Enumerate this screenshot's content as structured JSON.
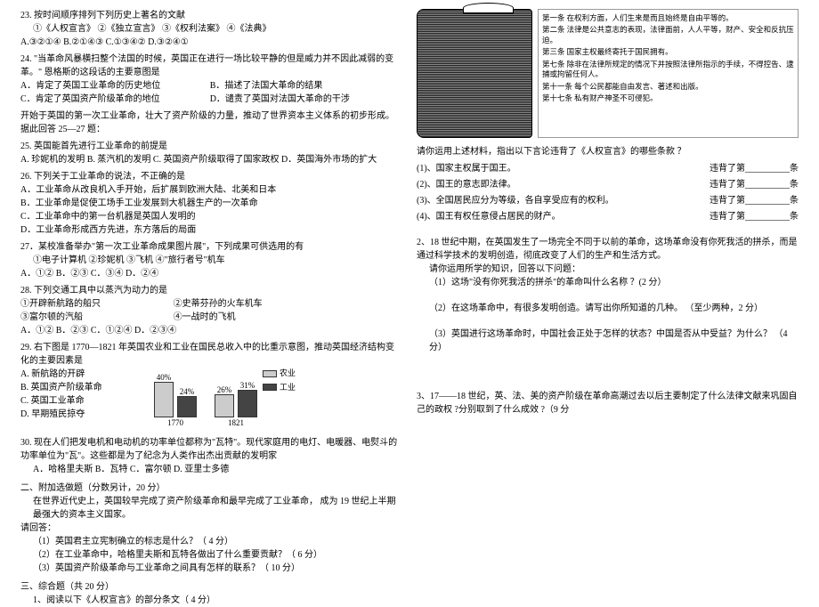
{
  "left": {
    "q23": {
      "stem": "23. 按时间顺序排列下列历史上著名的文献",
      "items": "①《人权宣言》 ②《独立宣言》 ③《权利法案》 ④《法典》",
      "opts": "A.③②①④     B.②①④③     C.①③④②     D.③②④①"
    },
    "q24": {
      "stem": "24. \"当革命风暴横扫整个法国的时候，英国正在进行一场比较平静的但是威力并不因此减弱的变革。\" 恩格斯的这段话的主要意图是",
      "a": "A．肯定了英国工业革命的历史地位",
      "b": "B．描述了法国大革命的结果",
      "c": "C．肯定了英国资产阶级革命的地位",
      "d": "D．谴责了英国对法国大革命的干涉"
    },
    "group25_27": "开始于英国的第一次工业革命，壮大了资产阶级的力量，推动了世界资本主义体系的初步形成。据此回答 25—27 题：",
    "q25": {
      "stem": "25. 英国能首先进行工业革命的前提是",
      "opts": "A. 珍妮机的发明   B. 蒸汽机的发明   C. 英国资产阶级取得了国家政权   D．英国海外市场的扩大"
    },
    "q26": {
      "stem": "26. 下列关于工业革命的说法，不正确的是",
      "a": "A．工业革命从改良机入手开始，后扩展到欧洲大陆、北美和日本",
      "b": "B．工业革命是促使工场手工业发展到大机器生产的一次革命",
      "c": "C．工业革命中的第一台机器是英国人发明的",
      "d": "D．工业革命形成西方先进，东方落后的局面"
    },
    "q27": {
      "stem": "27．某校准备举办\"第一次工业革命成果图片展\"，下列成果可供选用的有",
      "items": "①电子计算机   ②珍妮机   ③飞机   ④\"旅行者号\"机车",
      "opts": "A．①②   B．②③   C．③④   D．②④"
    },
    "q28": {
      "stem": "28. 下列交通工具中以蒸汽为动力的是",
      "row1a": "①开辟新航路的船只",
      "row1b": "②史蒂芬孙的火车机车",
      "row2a": "③富尔顿的汽船",
      "row2b": "④一战时的飞机",
      "opts": "A．①②   B．②③   C．①②④   D．②③④"
    },
    "q29": {
      "stem": "29. 右下图是 1770—1821 年英国农业和工业在国民总收入中的比重示意图，推动英国经济结构变化的主要因素是",
      "a": "A. 新航路的开辟",
      "b": "B. 英国资产阶级革命",
      "c": "C. 英国工业革命",
      "d": "D. 早期殖民掠夺",
      "x1": "1770",
      "x2": "1821",
      "leg_a": "农业",
      "leg_b": "工业"
    },
    "q30": {
      "stem": "30. 现在人们把发电机和电动机的功率单位都称为\"瓦特\"。现代家庭用的电灯、电暖器、电熨斗的功率单位为\"瓦\"。这些都是为了纪念为人类作出杰出贡献的发明家",
      "opts": "A．哈格里夫斯   B．瓦特   C．富尔顿   D. 亚里士多德"
    },
    "part2": {
      "title": "二、附加选做题（分数另计，20 分）",
      "intro": "在世界近代史上，英国较早完成了资产阶级革命和最早完成了工业革命，    成为 19 世纪上半期最强大的资本主义国家。",
      "ask": "请回答：",
      "sub1": "（1）英国君主立宪制确立的标志是什么？（  4 分）",
      "sub2": "（2）在工业革命中，哈格里夫斯和瓦特各做出了什么重要贡献？（  6 分）",
      "sub3": "（3）英国资产阶级革命与工业革命之间具有怎样的联系？（  10 分）"
    },
    "part3": {
      "title": "三、综合题（共 20 分）",
      "sub1": "1、阅读以下《人权宣言》的部分条文（  4 分）"
    }
  },
  "chart_data": {
    "type": "bar",
    "categories": [
      "1770",
      "1821"
    ],
    "series": [
      {
        "name": "农业",
        "values": [
          40,
          26
        ]
      },
      {
        "name": "工业",
        "values": [
          24,
          31
        ]
      }
    ],
    "ylabel": "%",
    "ylim": [
      0,
      45
    ]
  },
  "right": {
    "articles": {
      "a1": "第一条  在权利方面，人们生来是而且始终是自由平等的。",
      "a2": "第二条  法律是公共意志的表现，法律面前，人人平等，财产、安全和反抗压迫。",
      "a3": "第三条  国家主权最终寄托于国民拥有。",
      "a7": "第七条  除非在法律所规定的情况下并按照法律所指示的手续，不得控告、逮捕或拘留任何人。",
      "a11": "第十一条  每个公民都能自由发言、著述和出版。",
      "a17": "第十七条  私有财产神圣不可侵犯。"
    },
    "afterfig": "请你运用上述材料，指出以下言论违背了《人权宣言》的哪些条款  ？",
    "f1a": "(1)、国家主权属于国王。",
    "f1b": "违背了第__________条",
    "f2a": "(2)、国王的意志即法律。",
    "f2b": "违背了第__________条",
    "f3a": "(3)、全国居民应分为等级，各自享受应有的权利。",
    "f3b": "违背了第__________条",
    "f4a": "(4)、国王有权任意侵占居民的财产。",
    "f4b": "违背了第__________条",
    "q2": {
      "stem": "2、18 世纪中期，在英国发生了一场完全不同于以前的革命，这场革命没有你死我活的拼杀，而是通过科学技术的发明创造，彻底改变了人们的生产和生活方式。",
      "line2": "请你运用所学的知识，回答以下问题：",
      "s1": "（1）这场\"没有你死我活的拼杀\"的革命叫什么名称    ？(2 分）",
      "s2": "（2）在这场革命中，有很多发明创造。请写出你所知道的几种。  （至少两种，2 分）",
      "s3": "（3）英国进行这场革命时，中国社会正处于怎样的状态？中国是否从中受益？为什么？    （4 分）"
    },
    "q3": "3、17——18 世纪，英、法、美的资产阶级在革命高潮过去以后主要制定了什么法律文献来巩固自己的政权 ?分别取到了什么成效 ?（9 分"
  }
}
